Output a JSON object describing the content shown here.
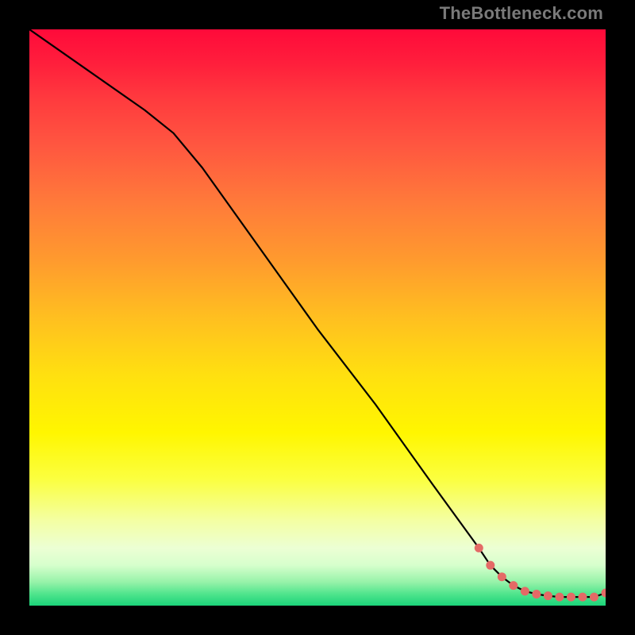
{
  "watermark": "TheBottleneck.com",
  "colors": {
    "frame": "#000000",
    "line": "#000000",
    "marker": "#e46a66",
    "gradient_top": "#ff0a3a",
    "gradient_bottom": "#1bd47a"
  },
  "chart_data": {
    "type": "line",
    "title": "",
    "xlabel": "",
    "ylabel": "",
    "xlim": [
      0,
      100
    ],
    "ylim": [
      0,
      100
    ],
    "series": [
      {
        "name": "bottleneck-curve",
        "x": [
          0,
          10,
          20,
          25,
          30,
          40,
          50,
          60,
          70,
          78,
          80,
          82,
          84,
          86,
          88,
          90,
          92,
          94,
          96,
          98,
          100
        ],
        "values": [
          100,
          93,
          86,
          82,
          76,
          62,
          48,
          35,
          21,
          10,
          7,
          5,
          3.5,
          2.5,
          2,
          1.7,
          1.5,
          1.5,
          1.5,
          1.5,
          2.2
        ]
      }
    ],
    "markers": {
      "name": "highlighted-points",
      "x": [
        78,
        80,
        82,
        84,
        86,
        88,
        90,
        92,
        94,
        96,
        98,
        100
      ],
      "values": [
        10,
        7,
        5,
        3.5,
        2.5,
        2,
        1.7,
        1.5,
        1.5,
        1.5,
        1.5,
        2.2
      ]
    }
  }
}
